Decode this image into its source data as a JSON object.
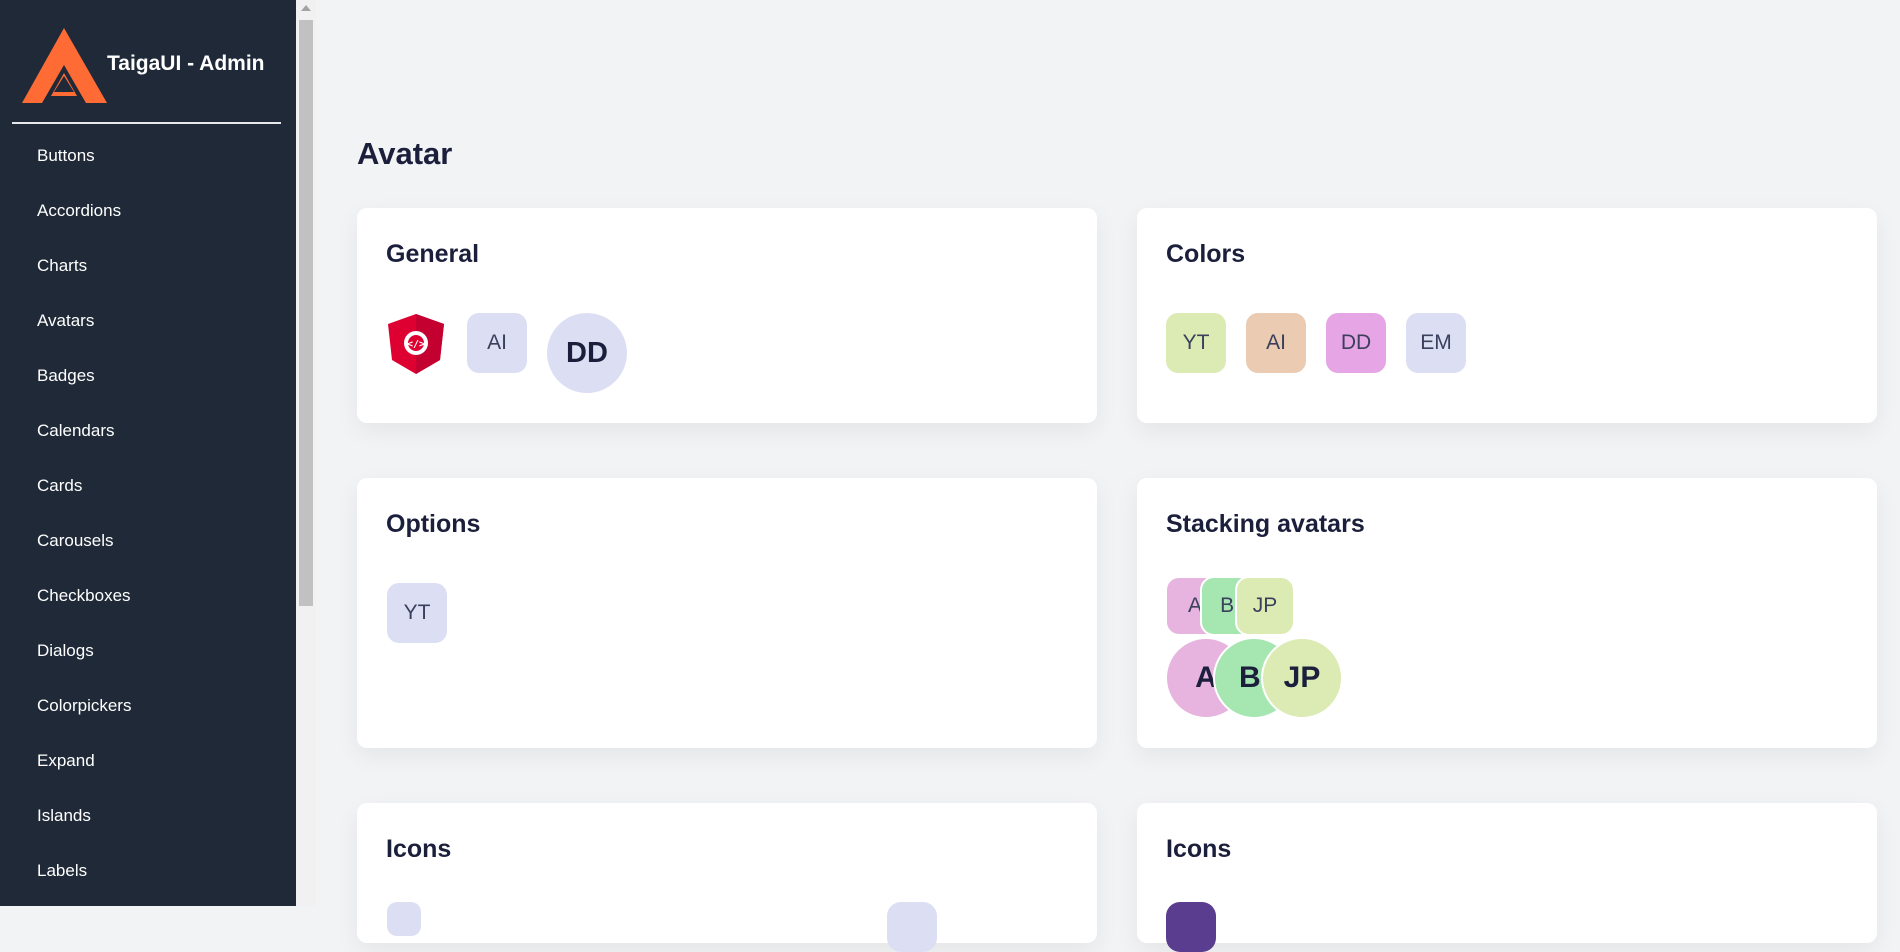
{
  "app": {
    "title": "TaigaUI - Admin"
  },
  "sidebar": {
    "items": [
      {
        "label": "Buttons"
      },
      {
        "label": "Accordions"
      },
      {
        "label": "Charts"
      },
      {
        "label": "Avatars"
      },
      {
        "label": "Badges"
      },
      {
        "label": "Calendars"
      },
      {
        "label": "Cards"
      },
      {
        "label": "Carousels"
      },
      {
        "label": "Checkboxes"
      },
      {
        "label": "Dialogs"
      },
      {
        "label": "Colorpickers"
      },
      {
        "label": "Expand"
      },
      {
        "label": "Islands"
      },
      {
        "label": "Labels"
      }
    ]
  },
  "page": {
    "title": "Avatar"
  },
  "cards": {
    "general": {
      "title": "General",
      "avatars": [
        "AI",
        "DD"
      ]
    },
    "colors": {
      "title": "Colors",
      "avatars": [
        "YT",
        "AI",
        "DD",
        "EM"
      ]
    },
    "options": {
      "title": "Options",
      "avatars": [
        "YT"
      ]
    },
    "stacking": {
      "title": "Stacking avatars",
      "small": [
        "A",
        "BI",
        "JP"
      ],
      "large": [
        "A",
        "BI",
        "JP"
      ]
    },
    "icons_left": {
      "title": "Icons"
    },
    "icons_right": {
      "title": "Icons"
    }
  },
  "colors": {
    "sidebar_bg": "#1f2937",
    "logo_orange": "#ff6b35",
    "angular_red": "#dd0031",
    "avatar_default": "#dcdff3",
    "avatar_green": "#dcebb4",
    "avatar_peach": "#ebcbb2",
    "avatar_pink": "#e6a6e6",
    "avatar_mint": "#a6e6b0"
  }
}
